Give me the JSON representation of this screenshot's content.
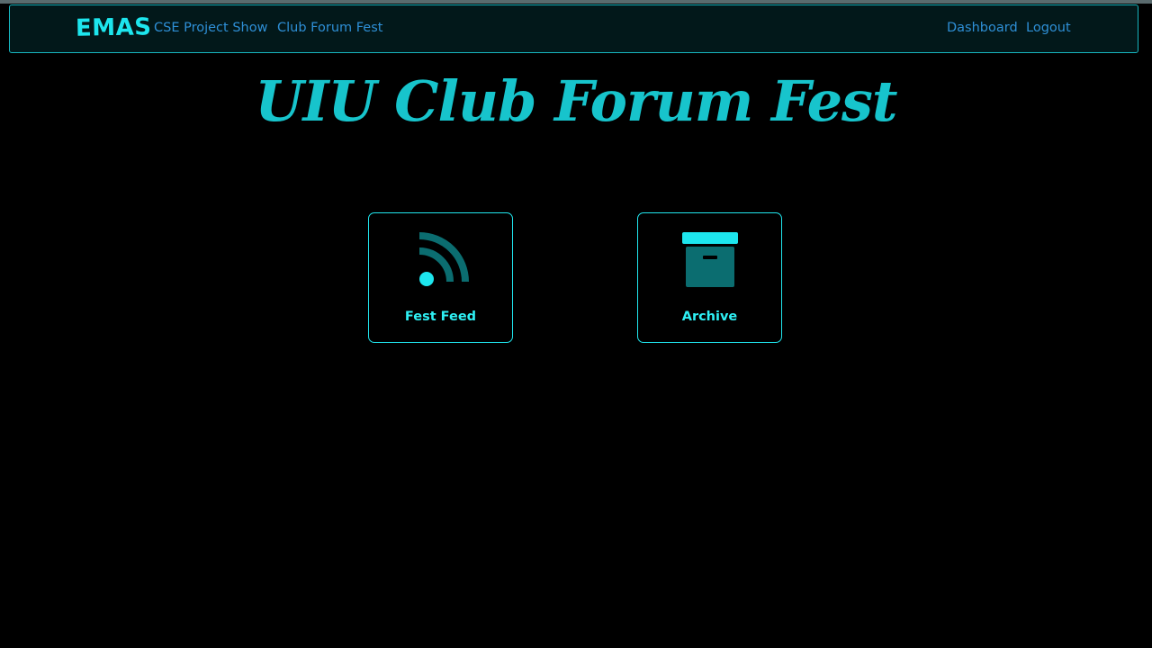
{
  "navbar": {
    "brand": "EMAS",
    "left_links": [
      {
        "label": "CSE Project Show"
      },
      {
        "label": "Club Forum Fest"
      }
    ],
    "right_links": [
      {
        "label": "Dashboard"
      },
      {
        "label": "Logout"
      }
    ]
  },
  "page": {
    "title": "UIU Club Forum Fest"
  },
  "cards": [
    {
      "label": "Fest Feed",
      "icon": "rss-feed-icon"
    },
    {
      "label": "Archive",
      "icon": "archive-box-icon"
    }
  ],
  "colors": {
    "background": "#000000",
    "accent_cyan": "#1de6ee",
    "title_teal": "#17c4cc",
    "link_blue": "#2e8fd6",
    "icon_dark_teal": "#0b6d70",
    "navbar_bg": "#02181a"
  }
}
